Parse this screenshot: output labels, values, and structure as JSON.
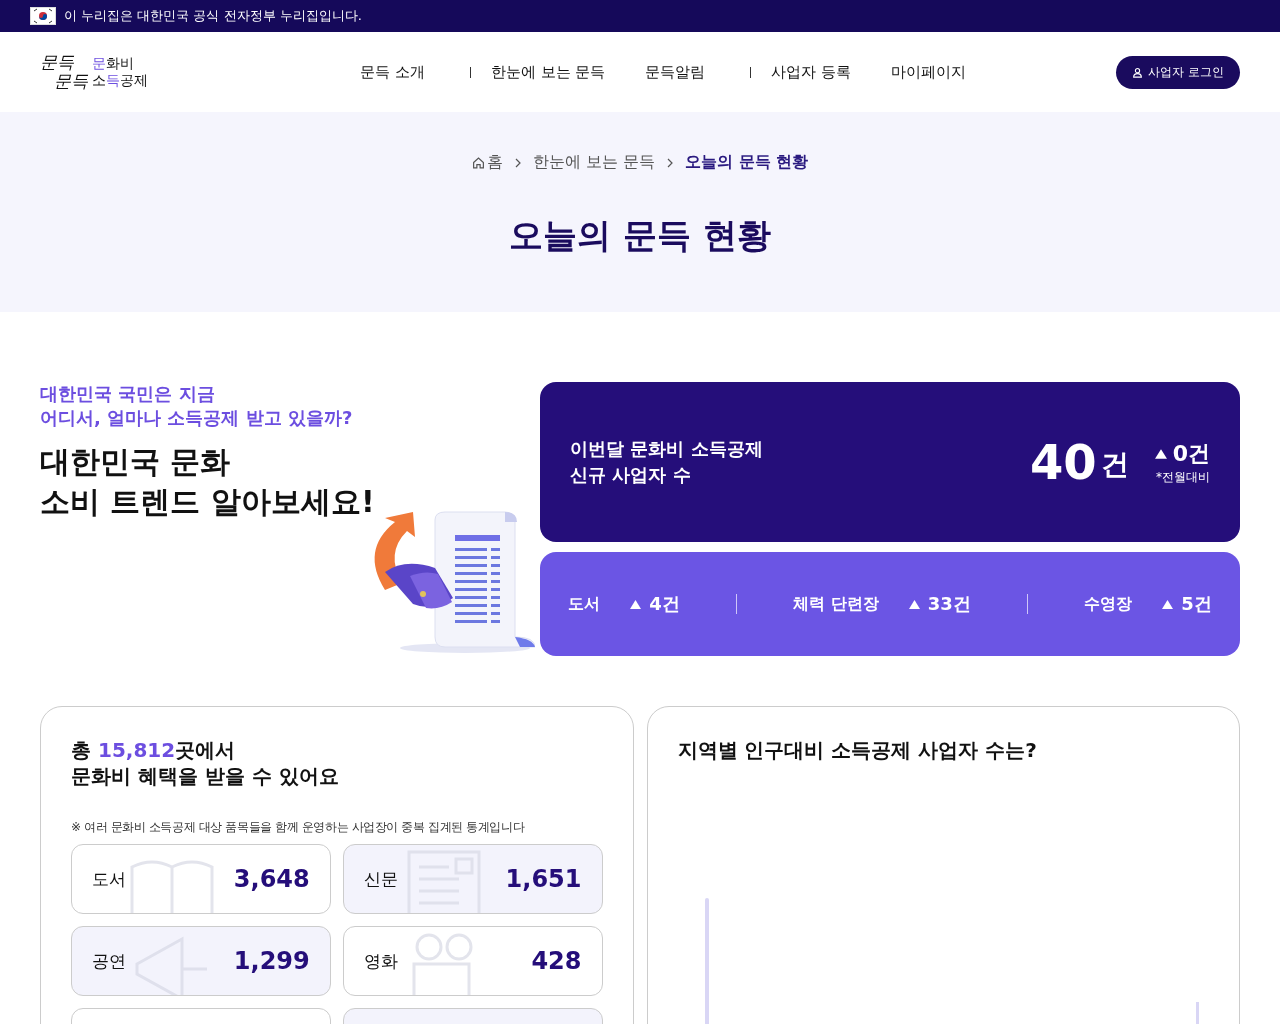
{
  "gov_banner": {
    "text": "이 누리집은 대한민국 공식 전자정부 누리집입니다."
  },
  "header": {
    "logo": {
      "script_lines": [
        "문득",
        "문득"
      ],
      "lines": [
        [
          {
            "text": "문",
            "accent": true
          },
          {
            "text": "화비",
            "accent": false
          }
        ],
        [
          {
            "text": "소",
            "accent": false
          },
          {
            "text": "득",
            "accent": true
          },
          {
            "text": "공제",
            "accent": false
          }
        ]
      ]
    },
    "nav": [
      {
        "label": "문득 소개",
        "separator_after": true
      },
      {
        "label": "한눈에 보는 문득",
        "separator_after": false
      },
      {
        "label": "문득알림",
        "separator_after": true
      },
      {
        "label": "사업자 등록",
        "separator_after": false
      },
      {
        "label": "마이페이지",
        "separator_after": false
      }
    ],
    "login_button": "사업자 로그인"
  },
  "breadcrumb": [
    {
      "label": "홈",
      "current": false
    },
    {
      "label": "한눈에 보는 문득",
      "current": false
    },
    {
      "label": "오늘의 문득 현황",
      "current": true
    }
  ],
  "page_title": "오늘의 문득 현황",
  "intro": {
    "subtitle_lines": [
      "대한민국 국민은 지금",
      "어디서, 얼마나 소득공제 받고 있을까?"
    ],
    "title_lines": [
      "대한민국 문화",
      "소비 트렌드 알아보세요!"
    ]
  },
  "new_business": {
    "label_lines": [
      "이번달 문화비 소득공제",
      "신규 사업자 수"
    ],
    "count": "40",
    "unit": "건",
    "change": "0건",
    "change_note": "*전월대비",
    "breakdown": [
      {
        "category": "도서",
        "change": "4건"
      },
      {
        "category": "체력 단련장",
        "change": "33건"
      },
      {
        "category": "수영장",
        "change": "5건"
      }
    ]
  },
  "places": {
    "title_prefix": "총 ",
    "title_count": "15,812",
    "title_suffix": "곳에서",
    "title_line2": "문화비 혜택을 받을 수 있어요",
    "note": "※ 여러 문화비 소득공제 대상 품목들을 함께 운영하는 사업장이 중복 집계된 통계입니다",
    "categories": [
      {
        "label": "도서",
        "count": "3,648",
        "tinted": false,
        "kind": "book"
      },
      {
        "label": "신문",
        "count": "1,651",
        "tinted": true,
        "kind": "newspaper"
      },
      {
        "label": "공연",
        "count": "1,299",
        "tinted": true,
        "kind": "megaphone"
      },
      {
        "label": "영화",
        "count": "428",
        "tinted": false,
        "kind": "camera"
      },
      {
        "tinted": false
      },
      {
        "tinted": true
      }
    ]
  },
  "regional": {
    "title": "지역별 인구대비 소득공제 사업자 수는?"
  }
}
